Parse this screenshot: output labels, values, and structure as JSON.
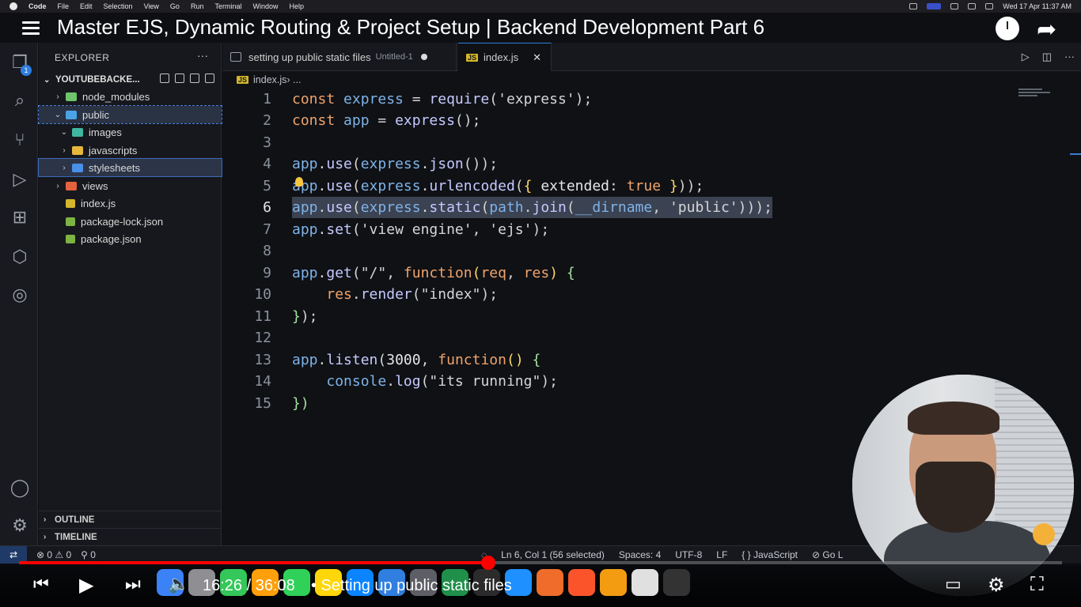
{
  "menubar": {
    "app": "Code",
    "items": [
      "File",
      "Edit",
      "Selection",
      "View",
      "Go",
      "Run",
      "Terminal",
      "Window",
      "Help"
    ],
    "clock": "Wed 17 Apr  11:37 AM"
  },
  "video": {
    "title": "Master EJS, Dynamic Routing & Project Setup | Backend Development Part 6",
    "time": "16:26 / 36:08",
    "chapter": "• Setting up public static files",
    "progress_fraction": 0.45
  },
  "activity": {
    "badge": "1"
  },
  "explorer": {
    "header": "EXPLORER",
    "project": "YOUTUBEBACKE...",
    "tree": [
      {
        "label": "node_modules",
        "chev": "›",
        "indent": 0,
        "color": "#6fc36b"
      },
      {
        "label": "public",
        "chev": "⌄",
        "indent": 0,
        "color": "#4aa3e8"
      },
      {
        "label": "images",
        "chev": "⌄",
        "indent": 1,
        "color": "#3fb7a0"
      },
      {
        "label": "javascripts",
        "chev": "›",
        "indent": 1,
        "color": "#e7b63d"
      },
      {
        "label": "stylesheets",
        "chev": "›",
        "indent": 1,
        "color": "#4a8fe8"
      },
      {
        "label": "views",
        "chev": "›",
        "indent": 0,
        "color": "#e5623e"
      },
      {
        "label": "index.js",
        "chev": "",
        "indent": 0,
        "color": "#d4b72a"
      },
      {
        "label": "package-lock.json",
        "chev": "",
        "indent": 0,
        "color": "#7cb342"
      },
      {
        "label": "package.json",
        "chev": "",
        "indent": 0,
        "color": "#7cb342"
      }
    ],
    "outline": "OUTLINE",
    "timeline": "TIMELINE"
  },
  "tabs": {
    "tab1": {
      "label": "setting up public static files",
      "sub": "Untitled-1"
    },
    "tab2": {
      "label": "index.js",
      "badge": "JS",
      "close": "✕"
    }
  },
  "breadcrumb": {
    "badge": "JS",
    "file": "index.js",
    "rest": " › ..."
  },
  "code_lines": [
    "1",
    "2",
    "3",
    "4",
    "5",
    "6",
    "7",
    "8",
    "9",
    "10",
    "11",
    "12",
    "13",
    "14",
    "15"
  ],
  "status": {
    "remote": "⇄",
    "errors": "⊗ 0 ⚠ 0",
    "ports": "⚲ 0",
    "position": "Ln 6, Col 1 (56 selected)",
    "spaces": "Spaces: 4",
    "encoding": "UTF-8",
    "eol": "LF",
    "language": "{ } JavaScript",
    "golive": "⊘ Go L"
  }
}
